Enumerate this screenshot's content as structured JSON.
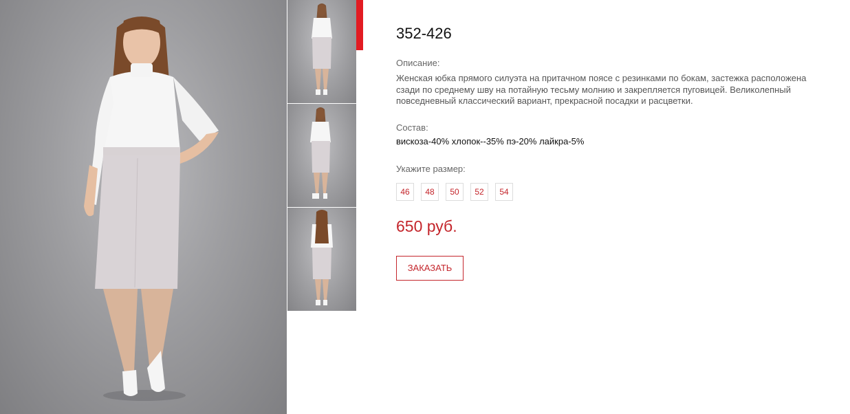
{
  "product": {
    "title": "352-426",
    "description_label": "Описание:",
    "description": "Женская юбка прямого силуэта на притачном поясе с резинками по бокам, застежка расположена сзади по среднему шву на потайную тесьму молнию и закрепляется пуговицей. Великолепный повседневный классический  вариант, прекрасной посадки и расцветки.",
    "composition_label": "Состав:",
    "composition": "вискоза-40% хлопок--35% пэ-20% лайкра-5%",
    "size_label": "Укажите размер:",
    "sizes": [
      "46",
      "48",
      "50",
      "52",
      "54"
    ],
    "price": "650 руб.",
    "order_label": "ЗАКАЗАТЬ"
  },
  "gallery": {
    "thumbnails": [
      "front-view",
      "front-view-2",
      "back-view"
    ],
    "active_index": 0
  },
  "colors": {
    "accent": "#c4252b",
    "active_bar": "#e21b22",
    "text_dark": "#111111",
    "text_muted": "#555555"
  }
}
